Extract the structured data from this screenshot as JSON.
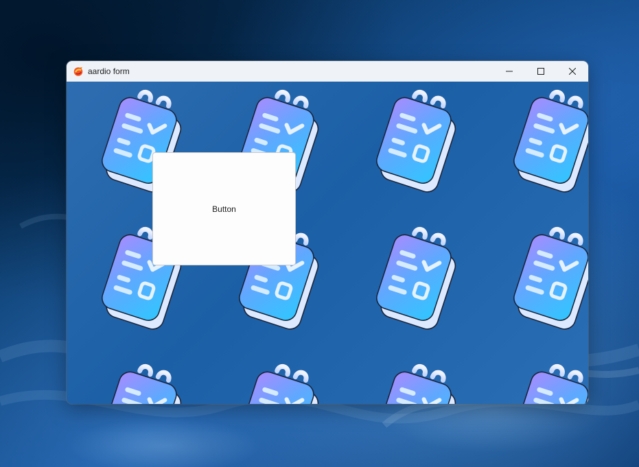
{
  "window": {
    "title": "aardio form",
    "app_icon": "aardio-logo-icon",
    "controls": {
      "minimize_icon": "minimize-icon",
      "maximize_icon": "maximize-icon",
      "close_icon": "close-icon"
    }
  },
  "form": {
    "button_label": "Button",
    "background_icon": "notepad-checklist-icon"
  },
  "colors": {
    "titlebar": "#eff3f8",
    "desktop_accent": "#145196",
    "icon_body": "#5aa8ff",
    "icon_accent": "#7b7cff"
  }
}
